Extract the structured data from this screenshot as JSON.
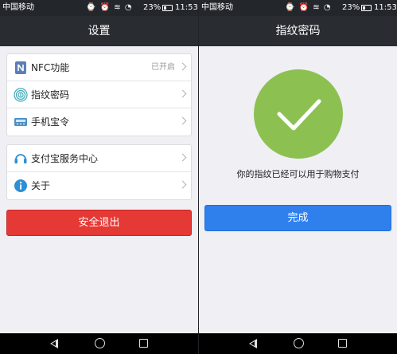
{
  "status_bar": {
    "carrier": "中国移动",
    "icons": [
      "sim-icon",
      "alarm-icon",
      "headphones-icon",
      "vibrate-icon",
      "clock-icon",
      "wifi-icon",
      "signal-icon"
    ],
    "battery": "23%",
    "time": "11:53"
  },
  "settings": {
    "title": "设置",
    "group1": [
      {
        "icon": "nfc-icon",
        "label": "NFC功能",
        "value": "已开启"
      },
      {
        "icon": "fingerprint-icon",
        "label": "指纹密码",
        "value": ""
      },
      {
        "icon": "phone-token-icon",
        "label": "手机宝令",
        "value": ""
      }
    ],
    "group2": [
      {
        "icon": "headset-icon",
        "label": "支付宝服务中心",
        "value": ""
      },
      {
        "icon": "info-icon",
        "label": "关于",
        "value": ""
      }
    ],
    "logout_label": "安全退出"
  },
  "fingerprint": {
    "title": "指纹密码",
    "message": "你的指纹已经可以用于购物支付",
    "done_label": "完成"
  },
  "colors": {
    "header": "#292d32",
    "logout": "#e53935",
    "done": "#2f80ed",
    "check_circle": "#8cc152"
  }
}
